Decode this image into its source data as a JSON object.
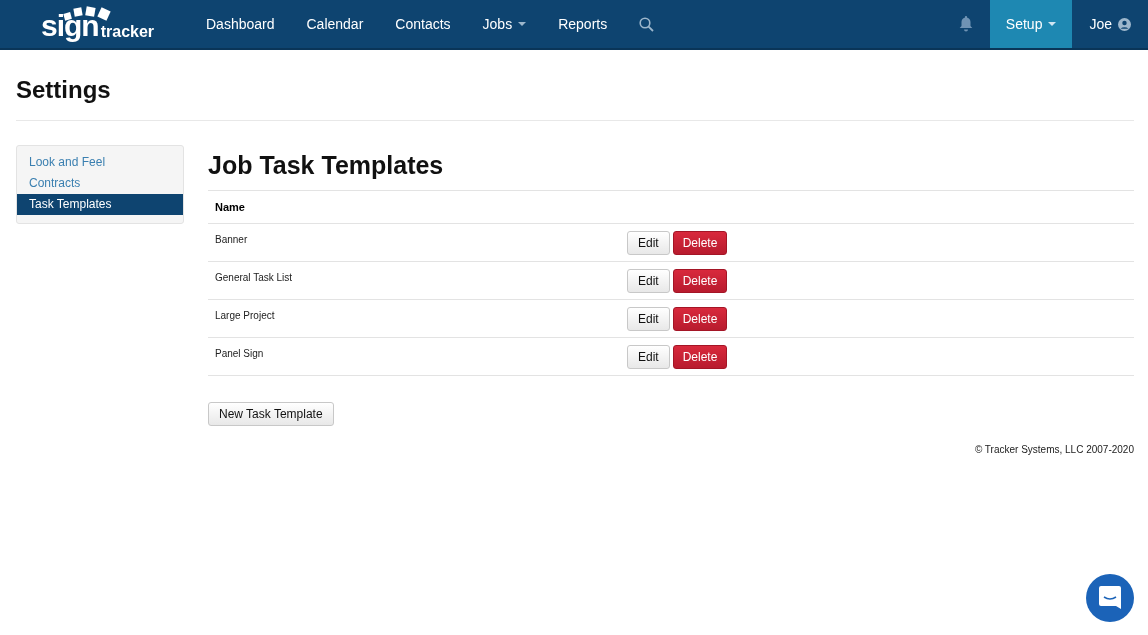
{
  "logo": {
    "word_1": "sign",
    "word_2": "tracker"
  },
  "nav": [
    {
      "label": "Dashboard",
      "dropdown": false,
      "selected": false
    },
    {
      "label": "Calendar",
      "dropdown": false,
      "selected": false
    },
    {
      "label": "Contacts",
      "dropdown": false,
      "selected": false
    },
    {
      "label": "Jobs",
      "dropdown": true,
      "selected": false
    },
    {
      "label": "Reports",
      "dropdown": false,
      "selected": false
    }
  ],
  "right_nav": [
    {
      "kind": "bell",
      "dropdown": false,
      "selected": false
    },
    {
      "kind": "text",
      "label": "Setup",
      "dropdown": true,
      "selected": true
    },
    {
      "kind": "user",
      "label": "Joe",
      "dropdown": false,
      "selected": false
    }
  ],
  "page_title": "Settings",
  "sidebar": {
    "items": [
      {
        "label": "Look and Feel",
        "selected": false
      },
      {
        "label": "Contracts",
        "selected": false
      },
      {
        "label": "Task Templates",
        "selected": true
      }
    ]
  },
  "section_title": "Job Task Templates",
  "table": {
    "columns": [
      "Name"
    ],
    "rows": [
      {
        "name": "Banner",
        "edit": "Edit",
        "delete": "Delete"
      },
      {
        "name": "General Task List",
        "edit": "Edit",
        "delete": "Delete"
      },
      {
        "name": "Large Project",
        "edit": "Edit",
        "delete": "Delete"
      },
      {
        "name": "Panel Sign",
        "edit": "Edit",
        "delete": "Delete"
      }
    ]
  },
  "new_button": "New Task Template",
  "footer": "© Tracker Systems, LLC 2007-2020"
}
